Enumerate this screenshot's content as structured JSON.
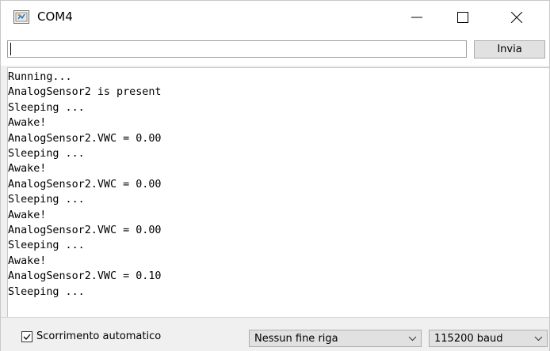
{
  "window": {
    "title": "COM4",
    "icon": "arduino-serial-monitor-icon"
  },
  "send": {
    "input_value": "",
    "button_label": "Invia"
  },
  "output": {
    "lines": [
      "Running...",
      "AnalogSensor2 is present",
      "Sleeping ...",
      "Awake!",
      "AnalogSensor2.VWC = 0.00",
      "Sleeping ...",
      "Awake!",
      "AnalogSensor2.VWC = 0.00",
      "Sleeping ...",
      "Awake!",
      "AnalogSensor2.VWC = 0.00",
      "Sleeping ...",
      "Awake!",
      "AnalogSensor2.VWC = 0.10",
      "Sleeping ..."
    ]
  },
  "statusbar": {
    "autoscroll_label": "Scorrimento automatico",
    "autoscroll_checked": true,
    "line_ending_value": "Nessun fine riga",
    "baud_value": "115200 baud"
  }
}
